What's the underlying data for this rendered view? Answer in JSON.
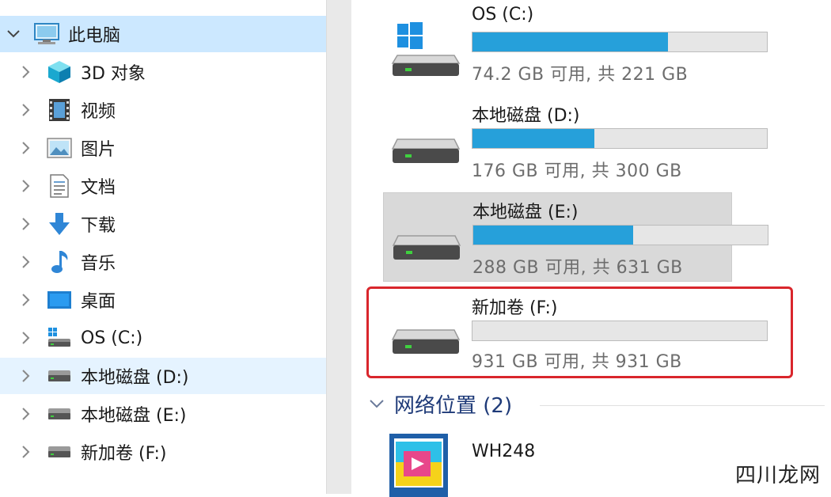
{
  "nav": {
    "items": [
      {
        "label": "此电脑",
        "icon": "computer-icon",
        "expanded": true,
        "selected": true
      },
      {
        "label": "3D 对象",
        "icon": "3d-objects-icon"
      },
      {
        "label": "视频",
        "icon": "video-icon"
      },
      {
        "label": "图片",
        "icon": "picture-icon"
      },
      {
        "label": "文档",
        "icon": "document-icon"
      },
      {
        "label": "下载",
        "icon": "download-icon"
      },
      {
        "label": "音乐",
        "icon": "music-icon"
      },
      {
        "label": "桌面",
        "icon": "desktop-icon"
      },
      {
        "label": "OS (C:)",
        "icon": "system-drive-icon"
      },
      {
        "label": "本地磁盘 (D:)",
        "icon": "drive-icon",
        "hovered": true
      },
      {
        "label": "本地磁盘 (E:)",
        "icon": "drive-icon"
      },
      {
        "label": "新加卷 (F:)",
        "icon": "drive-icon"
      }
    ]
  },
  "drives": [
    {
      "name": "OS (C:)",
      "info": "74.2 GB 可用, 共 221 GB",
      "used_fraction": 0.664,
      "system": true
    },
    {
      "name": "本地磁盘 (D:)",
      "info": "176 GB 可用, 共 300 GB",
      "used_fraction": 0.413
    },
    {
      "name": "本地磁盘 (E:)",
      "info": "288 GB 可用, 共 631 GB",
      "used_fraction": 0.544,
      "selected": true
    },
    {
      "name": "新加卷 (F:)",
      "info": "931 GB 可用, 共 931 GB",
      "used_fraction": 0.0,
      "highlighted": true
    }
  ],
  "network": {
    "section_title": "网络位置 (2)",
    "items": [
      {
        "label": "WH248",
        "icon": "media-server-icon"
      }
    ]
  },
  "watermark": "四川龙网",
  "colors": {
    "selection": "#cce8ff",
    "hover": "#e5f3ff",
    "bar_fill": "#26a0da",
    "highlight_border": "#d9262c",
    "section_title": "#1e3a78"
  }
}
